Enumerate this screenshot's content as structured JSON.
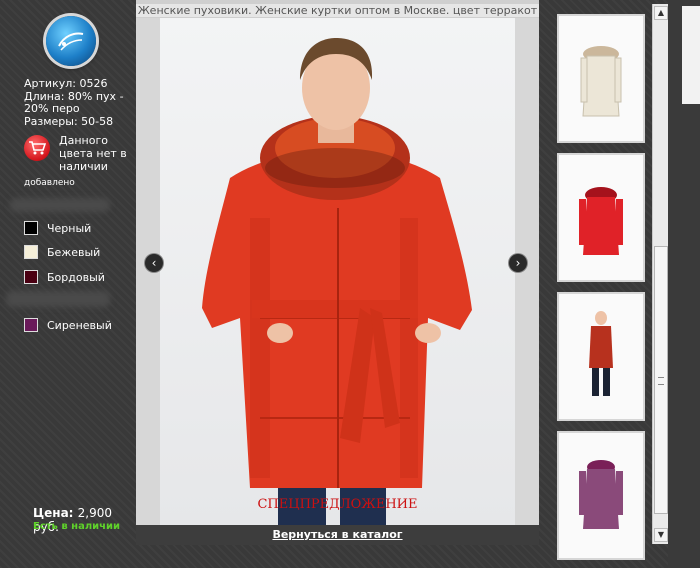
{
  "viewer": {
    "title": "Женские пуховики. Женские куртки оптом в Москве. цвет терракот",
    "special_offer": "СПЕЦПРЕДЛОЖЕНИЕ",
    "back_link": "Вернуться в каталог",
    "prev_icon": "chevron-left-icon",
    "next_icon": "chevron-right-icon"
  },
  "product": {
    "article": "Артикул: 0526",
    "length": "Длина: 80% пух - 20% перо",
    "sizes": "Размеры: 50-58",
    "unavailable": "Данного цвета нет в наличии",
    "added": "добавлено",
    "price_label": "Цена:",
    "price_value": "2,900 руб.",
    "in_stock": "Есть в наличии"
  },
  "colors": [
    {
      "name": "Черный",
      "hex": "#000000"
    },
    {
      "name": "Бежевый",
      "hex": "#f5efd9"
    },
    {
      "name": "Бордовый",
      "hex": "#4a0012"
    },
    {
      "name": "Сиреневый",
      "hex": "#6a1a5a"
    }
  ],
  "thumbnails": [
    {
      "icon": "jacket-beige-thumbnail"
    },
    {
      "icon": "jacket-red-thumbnail"
    },
    {
      "icon": "jacket-terracotta-thumbnail"
    },
    {
      "icon": "jacket-purple-thumbnail"
    }
  ]
}
